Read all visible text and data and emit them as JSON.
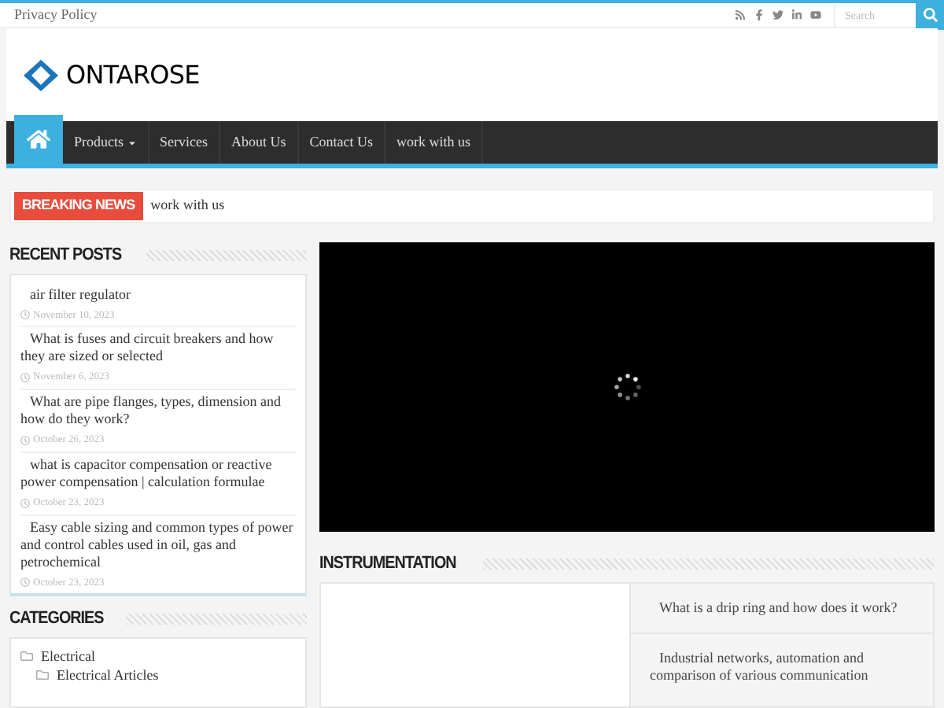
{
  "top_bar": {
    "links": [
      "Privacy Policy"
    ],
    "search": {
      "placeholder": "Search"
    }
  },
  "logo": {
    "text": "ONTAROSE"
  },
  "nav": {
    "items": [
      {
        "label": "Products",
        "dropdown": true
      },
      {
        "label": "Services",
        "dropdown": false
      },
      {
        "label": "About Us",
        "dropdown": false
      },
      {
        "label": "Contact Us",
        "dropdown": false
      },
      {
        "label": "work with us",
        "dropdown": false
      }
    ]
  },
  "breaking_news": {
    "label": "BREAKING NEWS",
    "text": "work with us"
  },
  "recent_posts": {
    "title": "RECENT POSTS",
    "posts": [
      {
        "title": "air filter regulator",
        "date": "November 10, 2023"
      },
      {
        "title": "What is fuses and circuit breakers and how they are sized or selected",
        "date": "November 6, 2023"
      },
      {
        "title": "What are pipe flanges, types, dimension and how do they work?",
        "date": "October 26, 2023"
      },
      {
        "title": "what is capacitor compensation or reactive power compensation | calculation formulae",
        "date": "October 23, 2023"
      },
      {
        "title": "Easy cable sizing and common types of power and control cables used in oil, gas and petrochemical",
        "date": "October 23, 2023"
      }
    ]
  },
  "categories": {
    "title": "CATEGORIES",
    "items": [
      {
        "label": "Electrical",
        "children": [
          {
            "label": "Electrical Articles"
          }
        ]
      }
    ]
  },
  "instrumentation": {
    "title": "INSTRUMENTATION",
    "posts": [
      "What is a drip ring and how does it work?",
      "Industrial networks, automation and comparison of various communication"
    ]
  }
}
